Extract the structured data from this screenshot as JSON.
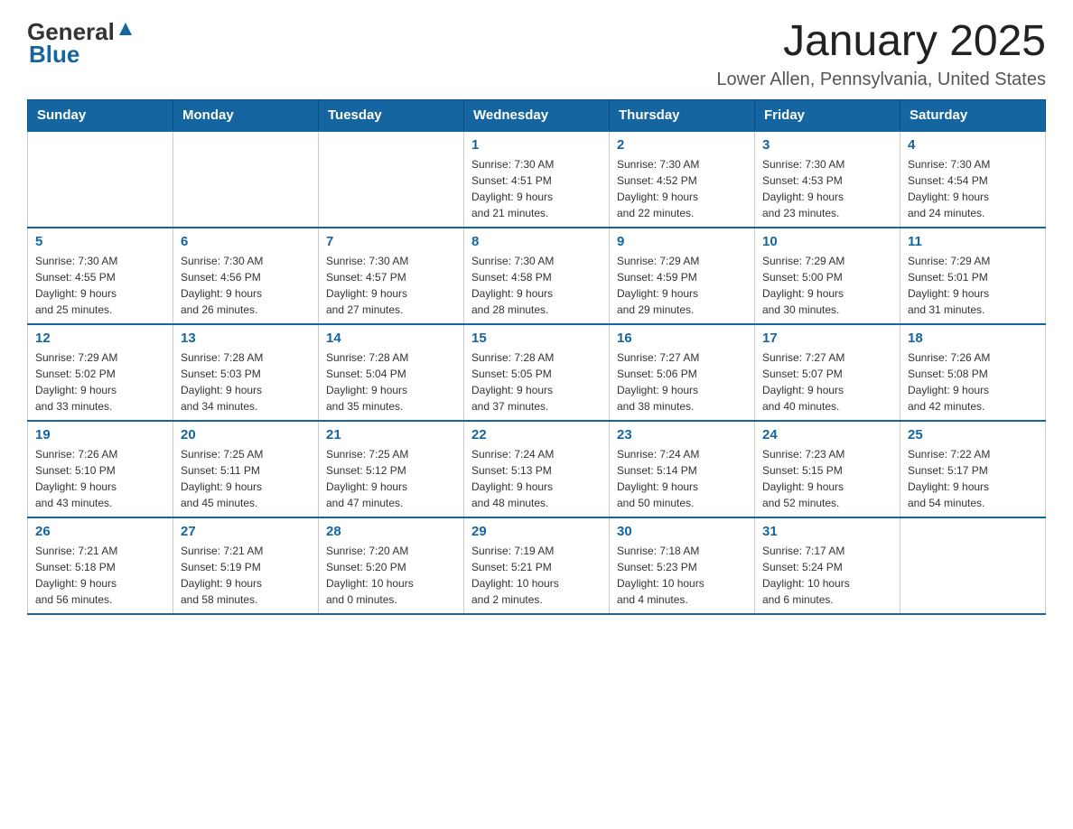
{
  "header": {
    "logo_text_black": "General",
    "logo_text_blue": "Blue",
    "main_title": "January 2025",
    "subtitle": "Lower Allen, Pennsylvania, United States"
  },
  "days_of_week": [
    "Sunday",
    "Monday",
    "Tuesday",
    "Wednesday",
    "Thursday",
    "Friday",
    "Saturday"
  ],
  "weeks": [
    [
      {
        "day": "",
        "info": ""
      },
      {
        "day": "",
        "info": ""
      },
      {
        "day": "",
        "info": ""
      },
      {
        "day": "1",
        "info": "Sunrise: 7:30 AM\nSunset: 4:51 PM\nDaylight: 9 hours\nand 21 minutes."
      },
      {
        "day": "2",
        "info": "Sunrise: 7:30 AM\nSunset: 4:52 PM\nDaylight: 9 hours\nand 22 minutes."
      },
      {
        "day": "3",
        "info": "Sunrise: 7:30 AM\nSunset: 4:53 PM\nDaylight: 9 hours\nand 23 minutes."
      },
      {
        "day": "4",
        "info": "Sunrise: 7:30 AM\nSunset: 4:54 PM\nDaylight: 9 hours\nand 24 minutes."
      }
    ],
    [
      {
        "day": "5",
        "info": "Sunrise: 7:30 AM\nSunset: 4:55 PM\nDaylight: 9 hours\nand 25 minutes."
      },
      {
        "day": "6",
        "info": "Sunrise: 7:30 AM\nSunset: 4:56 PM\nDaylight: 9 hours\nand 26 minutes."
      },
      {
        "day": "7",
        "info": "Sunrise: 7:30 AM\nSunset: 4:57 PM\nDaylight: 9 hours\nand 27 minutes."
      },
      {
        "day": "8",
        "info": "Sunrise: 7:30 AM\nSunset: 4:58 PM\nDaylight: 9 hours\nand 28 minutes."
      },
      {
        "day": "9",
        "info": "Sunrise: 7:29 AM\nSunset: 4:59 PM\nDaylight: 9 hours\nand 29 minutes."
      },
      {
        "day": "10",
        "info": "Sunrise: 7:29 AM\nSunset: 5:00 PM\nDaylight: 9 hours\nand 30 minutes."
      },
      {
        "day": "11",
        "info": "Sunrise: 7:29 AM\nSunset: 5:01 PM\nDaylight: 9 hours\nand 31 minutes."
      }
    ],
    [
      {
        "day": "12",
        "info": "Sunrise: 7:29 AM\nSunset: 5:02 PM\nDaylight: 9 hours\nand 33 minutes."
      },
      {
        "day": "13",
        "info": "Sunrise: 7:28 AM\nSunset: 5:03 PM\nDaylight: 9 hours\nand 34 minutes."
      },
      {
        "day": "14",
        "info": "Sunrise: 7:28 AM\nSunset: 5:04 PM\nDaylight: 9 hours\nand 35 minutes."
      },
      {
        "day": "15",
        "info": "Sunrise: 7:28 AM\nSunset: 5:05 PM\nDaylight: 9 hours\nand 37 minutes."
      },
      {
        "day": "16",
        "info": "Sunrise: 7:27 AM\nSunset: 5:06 PM\nDaylight: 9 hours\nand 38 minutes."
      },
      {
        "day": "17",
        "info": "Sunrise: 7:27 AM\nSunset: 5:07 PM\nDaylight: 9 hours\nand 40 minutes."
      },
      {
        "day": "18",
        "info": "Sunrise: 7:26 AM\nSunset: 5:08 PM\nDaylight: 9 hours\nand 42 minutes."
      }
    ],
    [
      {
        "day": "19",
        "info": "Sunrise: 7:26 AM\nSunset: 5:10 PM\nDaylight: 9 hours\nand 43 minutes."
      },
      {
        "day": "20",
        "info": "Sunrise: 7:25 AM\nSunset: 5:11 PM\nDaylight: 9 hours\nand 45 minutes."
      },
      {
        "day": "21",
        "info": "Sunrise: 7:25 AM\nSunset: 5:12 PM\nDaylight: 9 hours\nand 47 minutes."
      },
      {
        "day": "22",
        "info": "Sunrise: 7:24 AM\nSunset: 5:13 PM\nDaylight: 9 hours\nand 48 minutes."
      },
      {
        "day": "23",
        "info": "Sunrise: 7:24 AM\nSunset: 5:14 PM\nDaylight: 9 hours\nand 50 minutes."
      },
      {
        "day": "24",
        "info": "Sunrise: 7:23 AM\nSunset: 5:15 PM\nDaylight: 9 hours\nand 52 minutes."
      },
      {
        "day": "25",
        "info": "Sunrise: 7:22 AM\nSunset: 5:17 PM\nDaylight: 9 hours\nand 54 minutes."
      }
    ],
    [
      {
        "day": "26",
        "info": "Sunrise: 7:21 AM\nSunset: 5:18 PM\nDaylight: 9 hours\nand 56 minutes."
      },
      {
        "day": "27",
        "info": "Sunrise: 7:21 AM\nSunset: 5:19 PM\nDaylight: 9 hours\nand 58 minutes."
      },
      {
        "day": "28",
        "info": "Sunrise: 7:20 AM\nSunset: 5:20 PM\nDaylight: 10 hours\nand 0 minutes."
      },
      {
        "day": "29",
        "info": "Sunrise: 7:19 AM\nSunset: 5:21 PM\nDaylight: 10 hours\nand 2 minutes."
      },
      {
        "day": "30",
        "info": "Sunrise: 7:18 AM\nSunset: 5:23 PM\nDaylight: 10 hours\nand 4 minutes."
      },
      {
        "day": "31",
        "info": "Sunrise: 7:17 AM\nSunset: 5:24 PM\nDaylight: 10 hours\nand 6 minutes."
      },
      {
        "day": "",
        "info": ""
      }
    ]
  ]
}
